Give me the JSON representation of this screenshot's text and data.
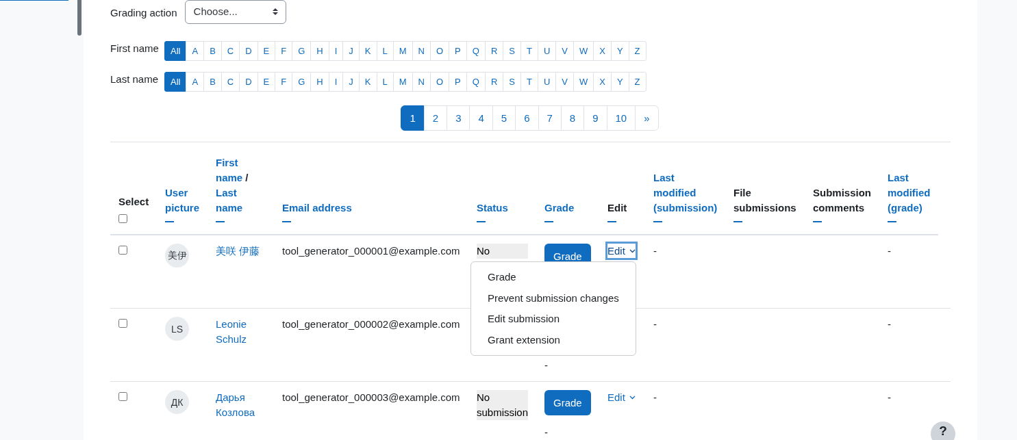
{
  "grading_action": {
    "label": "Grading action",
    "value": "Choose..."
  },
  "initials_filters": [
    {
      "label": "First name",
      "letters": [
        {
          "text": "All",
          "selected": true
        },
        {
          "text": "A",
          "selected": false
        },
        {
          "text": "B",
          "selected": false
        },
        {
          "text": "C",
          "selected": false
        },
        {
          "text": "D",
          "selected": false
        },
        {
          "text": "E",
          "selected": false
        },
        {
          "text": "F",
          "selected": false
        },
        {
          "text": "G",
          "selected": false
        },
        {
          "text": "H",
          "selected": false
        },
        {
          "text": "I",
          "selected": false
        },
        {
          "text": "J",
          "selected": false
        },
        {
          "text": "K",
          "selected": false
        },
        {
          "text": "L",
          "selected": false
        },
        {
          "text": "M",
          "selected": false
        },
        {
          "text": "N",
          "selected": false
        },
        {
          "text": "O",
          "selected": false
        },
        {
          "text": "P",
          "selected": false
        },
        {
          "text": "Q",
          "selected": false
        },
        {
          "text": "R",
          "selected": false
        },
        {
          "text": "S",
          "selected": false
        },
        {
          "text": "T",
          "selected": false
        },
        {
          "text": "U",
          "selected": false
        },
        {
          "text": "V",
          "selected": false
        },
        {
          "text": "W",
          "selected": false
        },
        {
          "text": "X",
          "selected": false
        },
        {
          "text": "Y",
          "selected": false
        },
        {
          "text": "Z",
          "selected": false
        }
      ]
    },
    {
      "label": "Last name",
      "letters": [
        {
          "text": "All",
          "selected": true
        },
        {
          "text": "A",
          "selected": false
        },
        {
          "text": "B",
          "selected": false
        },
        {
          "text": "C",
          "selected": false
        },
        {
          "text": "D",
          "selected": false
        },
        {
          "text": "E",
          "selected": false
        },
        {
          "text": "F",
          "selected": false
        },
        {
          "text": "G",
          "selected": false
        },
        {
          "text": "H",
          "selected": false
        },
        {
          "text": "I",
          "selected": false
        },
        {
          "text": "J",
          "selected": false
        },
        {
          "text": "K",
          "selected": false
        },
        {
          "text": "L",
          "selected": false
        },
        {
          "text": "M",
          "selected": false
        },
        {
          "text": "N",
          "selected": false
        },
        {
          "text": "O",
          "selected": false
        },
        {
          "text": "P",
          "selected": false
        },
        {
          "text": "Q",
          "selected": false
        },
        {
          "text": "R",
          "selected": false
        },
        {
          "text": "S",
          "selected": false
        },
        {
          "text": "T",
          "selected": false
        },
        {
          "text": "U",
          "selected": false
        },
        {
          "text": "V",
          "selected": false
        },
        {
          "text": "W",
          "selected": false
        },
        {
          "text": "X",
          "selected": false
        },
        {
          "text": "Y",
          "selected": false
        },
        {
          "text": "Z",
          "selected": false
        }
      ]
    }
  ],
  "pagination": [
    {
      "text": "1",
      "selected": true
    },
    {
      "text": "2",
      "selected": false
    },
    {
      "text": "3",
      "selected": false
    },
    {
      "text": "4",
      "selected": false
    },
    {
      "text": "5",
      "selected": false
    },
    {
      "text": "6",
      "selected": false
    },
    {
      "text": "7",
      "selected": false
    },
    {
      "text": "8",
      "selected": false
    },
    {
      "text": "9",
      "selected": false
    },
    {
      "text": "10",
      "selected": false
    },
    {
      "text": "»",
      "selected": false
    }
  ],
  "table": {
    "columns": [
      {
        "label": "Select",
        "kind": "select",
        "all_selected": false
      },
      {
        "label": "User picture",
        "kind": "link"
      },
      {
        "label": "First name",
        "separator": "/",
        "label_2": "Last name",
        "kind": "name"
      },
      {
        "label": "Email address",
        "kind": "link"
      },
      {
        "label": "Status",
        "kind": "link"
      },
      {
        "label": "Grade",
        "kind": "link"
      },
      {
        "label": "Edit",
        "kind": "plain"
      },
      {
        "label": "Last modified (submission)",
        "kind": "link"
      },
      {
        "label": "File submissions",
        "kind": "plain"
      },
      {
        "label": "Submission comments",
        "kind": "plain"
      },
      {
        "label": "Last modified (grade)",
        "kind": "link"
      }
    ],
    "rows": [
      {
        "checked": false,
        "initials": "美伊",
        "name": "美咲 伊藤",
        "email": "tool_generator_000001@example.com",
        "status": "No",
        "grade_button": "Grade",
        "edit": "Edit",
        "edit_focused": true,
        "last_modified_submission": "-",
        "last_modified_grade": "-"
      },
      {
        "checked": false,
        "initials": "LS",
        "name": "Leonie Schulz",
        "email": "tool_generator_000002@example.com",
        "grade": "-",
        "last_modified_submission": "-",
        "last_modified_grade": "-"
      },
      {
        "checked": false,
        "initials": "ДК",
        "name": "Дарья Козлова",
        "email": "tool_generator_000003@example.com",
        "status": "No submission",
        "grade_button": "Grade",
        "grade": "-",
        "edit": "Edit",
        "edit_focused": false,
        "last_modified_submission": "-",
        "last_modified_grade": "-"
      }
    ]
  },
  "edit_menu": {
    "items": [
      "Grade",
      "Prevent submission changes",
      "Edit submission",
      "Grant extension"
    ]
  },
  "help_button": {
    "label": "?"
  }
}
